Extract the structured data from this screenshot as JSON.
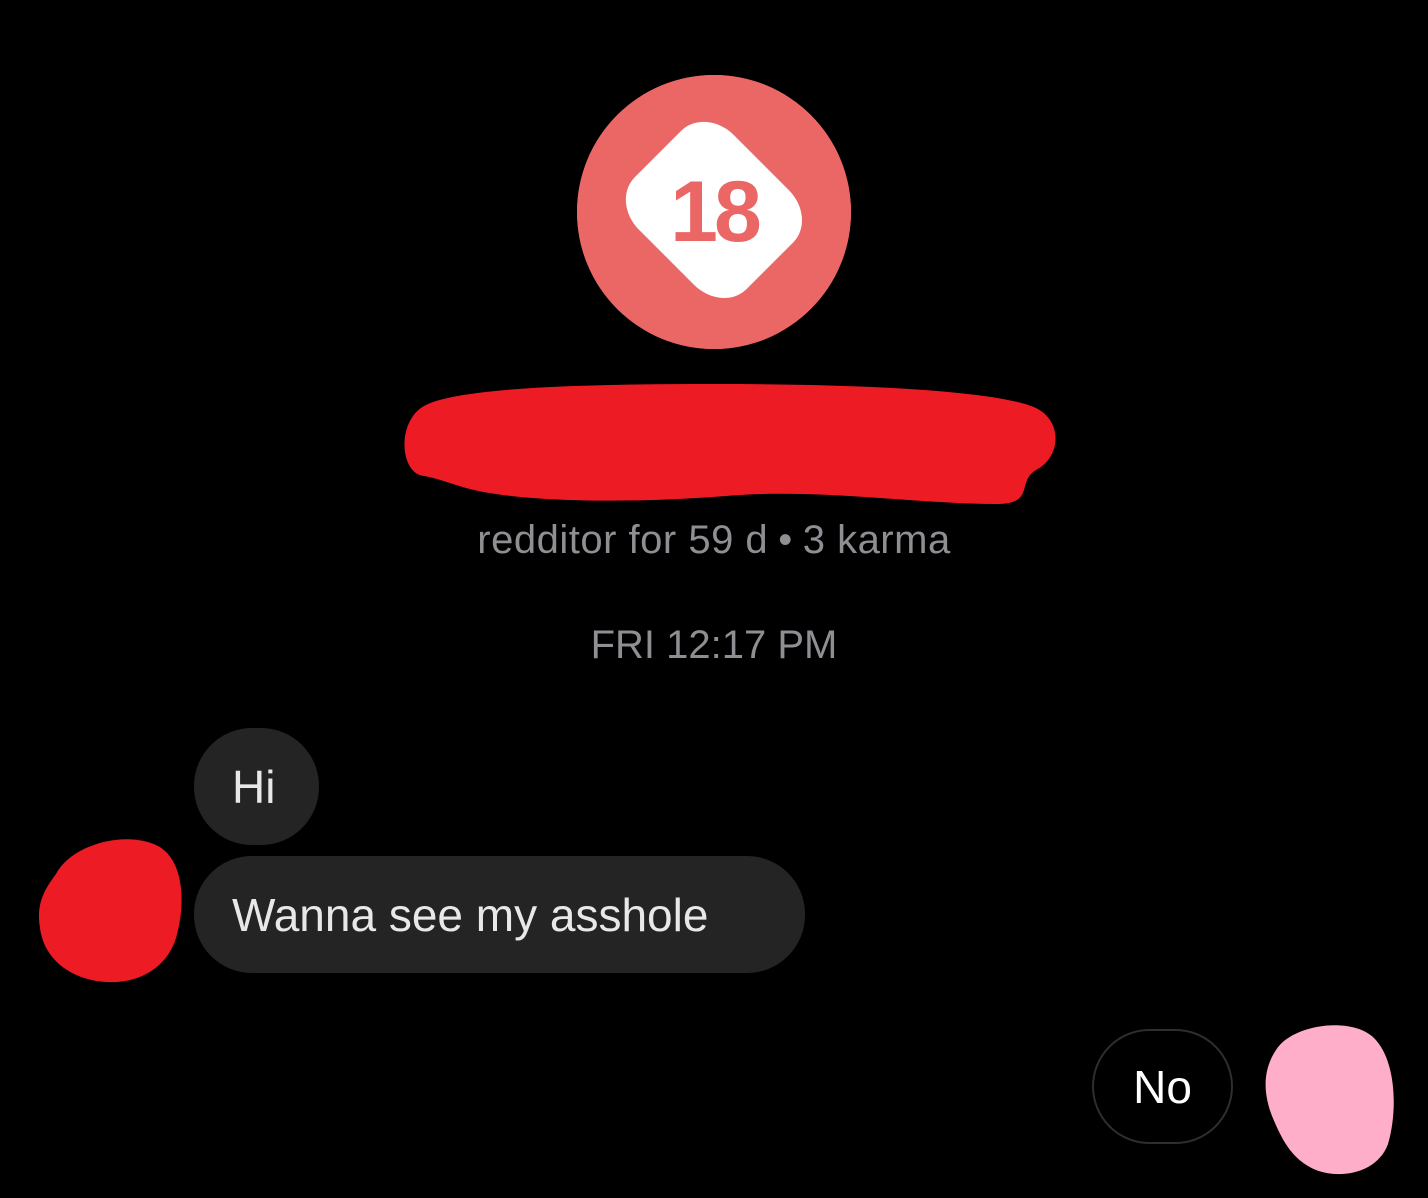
{
  "profile": {
    "avatar_text": "18",
    "avatar_color": "#ea6766",
    "avatar_icon": "nsfw-18-icon",
    "meta_age": "redditor for 59 d",
    "meta_separator": "•",
    "meta_karma": "3 karma"
  },
  "conversation": {
    "timestamp": "FRI 12:17 PM",
    "incoming": [
      {
        "text": "Hi"
      },
      {
        "text": "Wanna see my asshole"
      }
    ],
    "outgoing": [
      {
        "text": "No"
      }
    ]
  },
  "redactions": {
    "username_color": "#ed1c24",
    "sender_avatar_color": "#ed1c24",
    "my_avatar_color": "#ffaec9"
  }
}
